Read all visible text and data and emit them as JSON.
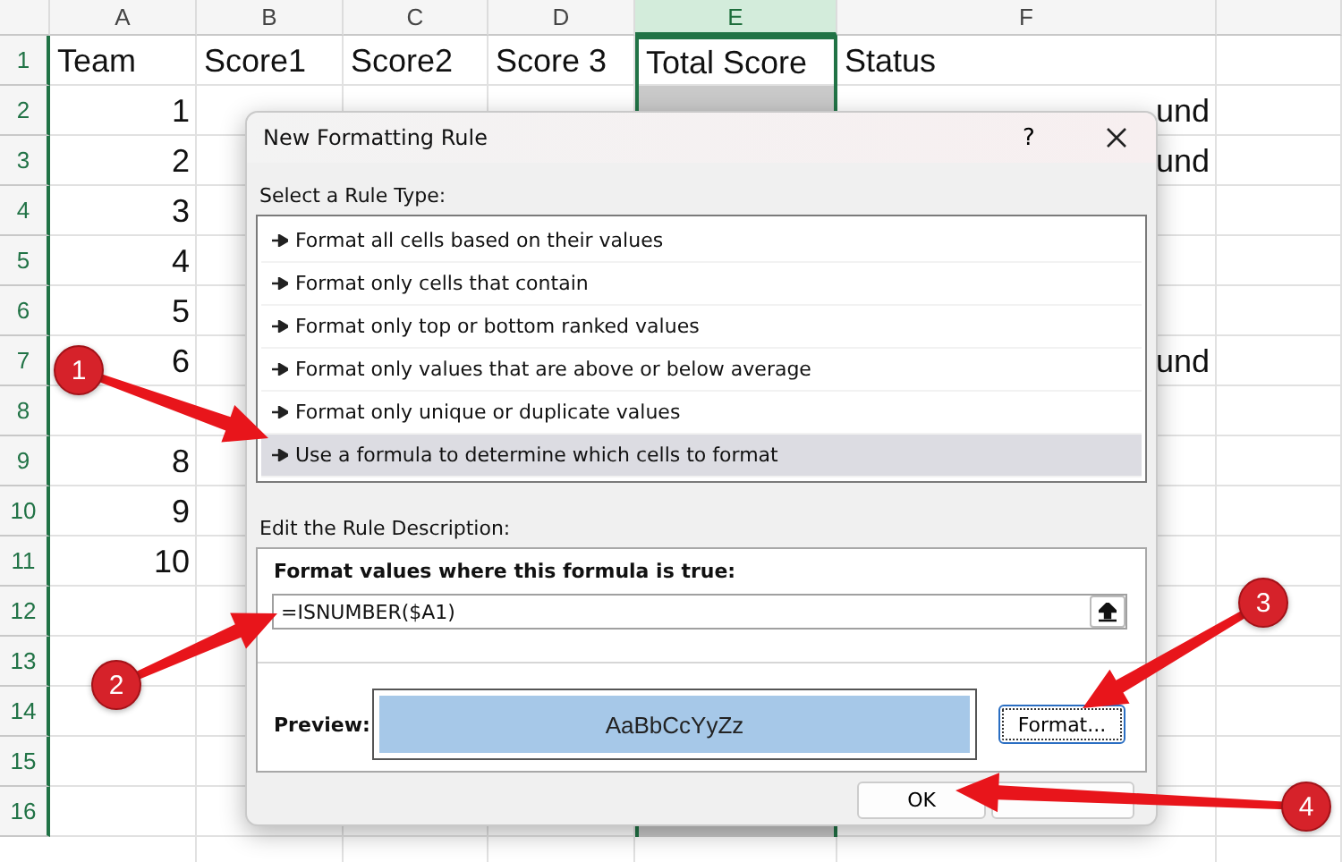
{
  "spreadsheet": {
    "columns": [
      {
        "label": "A",
        "selected": false
      },
      {
        "label": "B",
        "selected": false
      },
      {
        "label": "C",
        "selected": false
      },
      {
        "label": "D",
        "selected": false
      },
      {
        "label": "E",
        "selected": true
      },
      {
        "label": "F",
        "selected": false
      }
    ],
    "rows": [
      {
        "number": "1",
        "a": "Team",
        "b": "Score1",
        "c": "Score2",
        "d": "Score 3",
        "e": "Total Score",
        "f": "Status"
      },
      {
        "number": "2",
        "a": "1",
        "f": "und"
      },
      {
        "number": "3",
        "a": "2",
        "f": "und"
      },
      {
        "number": "4",
        "a": "3"
      },
      {
        "number": "5",
        "a": "4"
      },
      {
        "number": "6",
        "a": "5"
      },
      {
        "number": "7",
        "a": "6",
        "f": "und"
      },
      {
        "number": "8"
      },
      {
        "number": "9",
        "a": "8"
      },
      {
        "number": "10",
        "a": "9"
      },
      {
        "number": "11",
        "a": "10"
      },
      {
        "number": "12"
      },
      {
        "number": "13"
      },
      {
        "number": "14"
      },
      {
        "number": "15"
      },
      {
        "number": "16"
      }
    ]
  },
  "dialog": {
    "title": "New Formatting Rule",
    "help": "?",
    "rule_type_label": "Select a Rule Type:",
    "rule_types": [
      {
        "label": "Format all cells based on their values",
        "selected": false
      },
      {
        "label": "Format only cells that contain",
        "selected": false
      },
      {
        "label": "Format only top or bottom ranked values",
        "selected": false
      },
      {
        "label": "Format only values that are above or below average",
        "selected": false
      },
      {
        "label": "Format only unique or duplicate values",
        "selected": false
      },
      {
        "label": "Use a formula to determine which cells to format",
        "selected": true
      }
    ],
    "description_label": "Edit the Rule Description:",
    "formula_label": "Format values where this formula is true:",
    "formula": "=ISNUMBER($A1)",
    "preview_label": "Preview:",
    "preview_sample": "AaBbCcYyZz",
    "format_button": "Format...",
    "ok_button": "OK"
  },
  "callouts": [
    {
      "number": "1"
    },
    {
      "number": "2"
    },
    {
      "number": "3"
    },
    {
      "number": "4"
    }
  ]
}
